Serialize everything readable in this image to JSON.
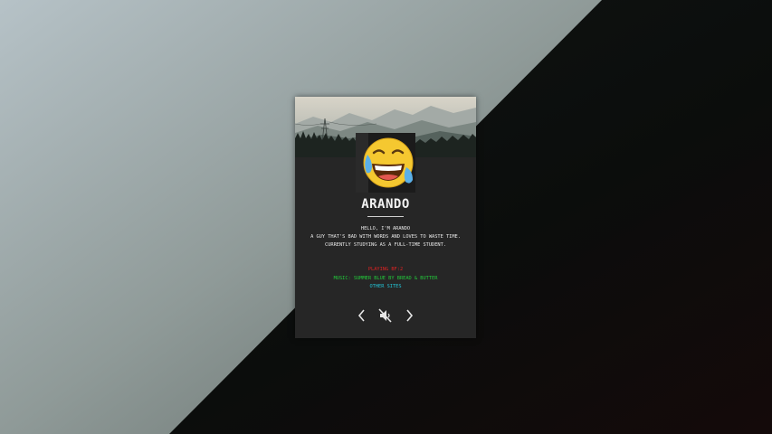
{
  "profile": {
    "name": "ARANDO",
    "bio_lines": [
      "HELLO, I'M ARANDO",
      "A GUY THAT'S BAD WITH WORDS AND LOVES TO WASTE TIME.",
      "CURRENTLY STUDYING AS A FULL-TIME STUDENT."
    ]
  },
  "links": {
    "playing": "PLAYING BF:2",
    "music": "MUSIC: SUMMER BLUE BY BREAD & BUTTER",
    "other_sites": "OTHER SITES"
  },
  "colors": {
    "playing": "#e02222",
    "music": "#22c93a",
    "other_sites": "#22c3d6"
  },
  "controls": {
    "prev_icon": "chevron-left-icon",
    "mute_icon": "speaker-muted-icon",
    "next_icon": "chevron-right-icon"
  }
}
